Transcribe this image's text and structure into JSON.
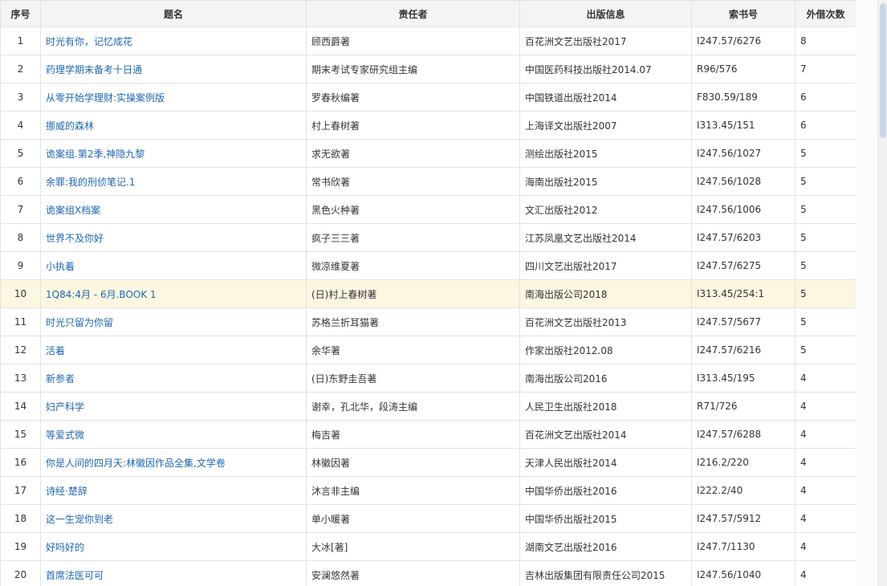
{
  "columns": [
    "序号",
    "题名",
    "责任者",
    "出版信息",
    "索书号",
    "外借次数"
  ],
  "rows": [
    {
      "seq": "1",
      "title": "时光有你，记忆成花",
      "author": "顾西爵著",
      "pub": "百花洲文艺出版社2017",
      "call": "I247.57/6276",
      "loans": "8"
    },
    {
      "seq": "2",
      "title": "药理学期末备考十日通",
      "author": "期末考试专家研究组主编",
      "pub": "中国医药科技出版社2014.07",
      "call": "R96/576",
      "loans": "7"
    },
    {
      "seq": "3",
      "title": "从零开始学理财:实操案例版",
      "author": "罗春秋编著",
      "pub": "中国铁道出版社2014",
      "call": "F830.59/189",
      "loans": "6"
    },
    {
      "seq": "4",
      "title": "挪威的森林",
      "author": "村上春树著",
      "pub": "上海译文出版社2007",
      "call": "I313.45/151",
      "loans": "6"
    },
    {
      "seq": "5",
      "title": "诡案组.第2季,神隐九黎",
      "author": "求无欲著",
      "pub": "测绘出版社2015",
      "call": "I247.56/1027",
      "loans": "5"
    },
    {
      "seq": "6",
      "title": "余罪:我的刑侦笔记.1",
      "author": "常书欣著",
      "pub": "海南出版社2015",
      "call": "I247.56/1028",
      "loans": "5"
    },
    {
      "seq": "7",
      "title": "诡案组X档案",
      "author": "黑色火种著",
      "pub": "文汇出版社2012",
      "call": "I247.56/1006",
      "loans": "5"
    },
    {
      "seq": "8",
      "title": "世界不及你好",
      "author": "疯子三三著",
      "pub": "江苏凤凰文艺出版社2014",
      "call": "I247.57/6203",
      "loans": "5"
    },
    {
      "seq": "9",
      "title": "小执着",
      "author": "微凉维夏著",
      "pub": "四川文艺出版社2017",
      "call": "I247.57/6275",
      "loans": "5"
    },
    {
      "seq": "10",
      "title": "1Q84:4月 - 6月.BOOK 1",
      "author": "(日)村上春树著",
      "pub": "南海出版公司2018",
      "call": "I313.45/254:1",
      "loans": "5"
    },
    {
      "seq": "11",
      "title": "时光只留为你留",
      "author": "苏格兰折耳猫著",
      "pub": "百花洲文艺出版社2013",
      "call": "I247.57/5677",
      "loans": "5"
    },
    {
      "seq": "12",
      "title": "活着",
      "author": "余华著",
      "pub": "作家出版社2012.08",
      "call": "I247.57/6216",
      "loans": "5"
    },
    {
      "seq": "13",
      "title": "新参者",
      "author": "(日)东野圭吾著",
      "pub": "南海出版公司2016",
      "call": "I313.45/195",
      "loans": "4"
    },
    {
      "seq": "14",
      "title": "妇产科学",
      "author": "谢幸，孔北华，段涛主编",
      "pub": "人民卫生出版社2018",
      "call": "R71/726",
      "loans": "4"
    },
    {
      "seq": "15",
      "title": "等爱式微",
      "author": "梅吉著",
      "pub": "百花洲文艺出版社2014",
      "call": "I247.57/6288",
      "loans": "4"
    },
    {
      "seq": "16",
      "title": "你是人间的四月天:林徽因作品全集,文学卷",
      "author": "林徽因著",
      "pub": "天津人民出版社2014",
      "call": "I216.2/220",
      "loans": "4"
    },
    {
      "seq": "17",
      "title": "诗经·楚辞",
      "author": "沐言非主编",
      "pub": "中国华侨出版社2016",
      "call": "I222.2/40",
      "loans": "4"
    },
    {
      "seq": "18",
      "title": "这一生宠你到老",
      "author": "单小暖著",
      "pub": "中国华侨出版社2015",
      "call": "I247.57/5912",
      "loans": "4"
    },
    {
      "seq": "19",
      "title": "好吗好的",
      "author": "大冰[著]",
      "pub": "湖南文艺出版社2016",
      "call": "I247.7/1130",
      "loans": "4"
    },
    {
      "seq": "20",
      "title": "首席法医可可",
      "author": "安澜悠然著",
      "pub": "吉林出版集团有限责任公司2015",
      "call": "I247.56/1040",
      "loans": "4"
    }
  ],
  "highlight_row": "10"
}
